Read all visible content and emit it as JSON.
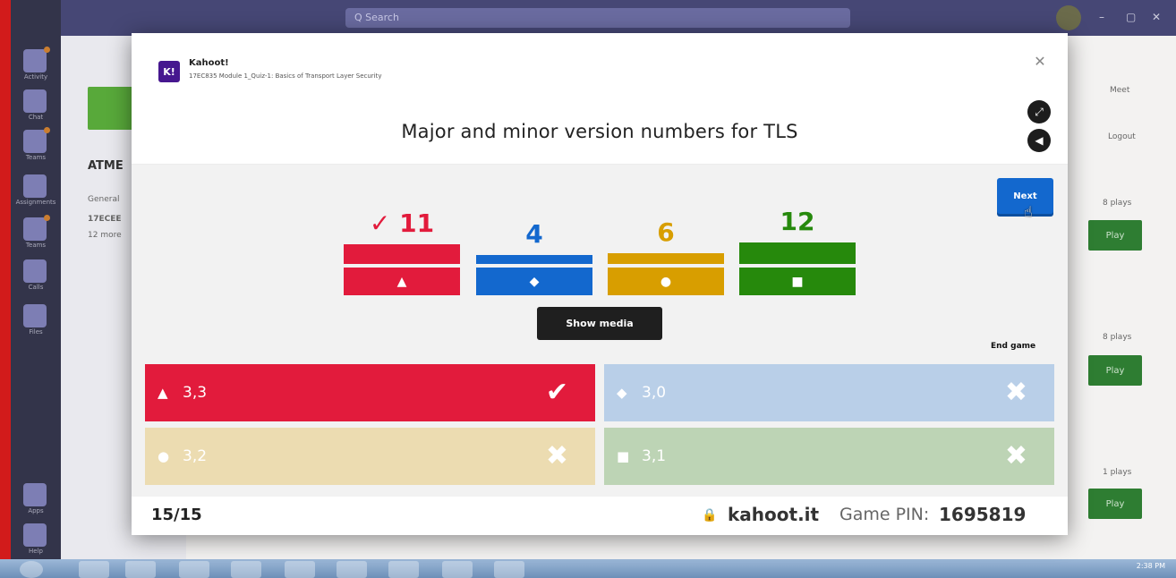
{
  "teams": {
    "search_placeholder": "Q Search",
    "team_title": "ATME",
    "list_items": [
      "General",
      "17ECEE",
      "12 more"
    ],
    "rail_labels": [
      "Activity",
      "Chat",
      "Teams",
      "Assignments",
      "Teams",
      "Calls",
      "Files",
      "Apps",
      "Help"
    ],
    "right_items": [
      "Play",
      "Play",
      "Play"
    ],
    "right_meta": [
      "Logout",
      "8 plays",
      "8 plays",
      "1 plays"
    ],
    "meet_label": "Meet",
    "taskbar_clock": "2:38 PM"
  },
  "kahoot": {
    "app_name": "Kahoot!",
    "logo_text": "K!",
    "subtitle": "17EC835 Module 1_Quiz-1: Basics of Transport Layer Security",
    "question": "Major and minor version numbers for TLS",
    "next_label": "Next",
    "show_media_label": "Show media",
    "end_game_label": "End game",
    "results": [
      {
        "count_label": "✓ 11",
        "count": 11,
        "color": "#e21b3c",
        "shape": "triangle",
        "correct": true
      },
      {
        "count_label": "4",
        "count": 4,
        "color": "#1368ce",
        "shape": "diamond",
        "correct": false
      },
      {
        "count_label": "6",
        "count": 6,
        "color": "#d89e00",
        "shape": "circle",
        "correct": false
      },
      {
        "count_label": "12",
        "count": 12,
        "color": "#26890c",
        "shape": "square",
        "correct": false
      }
    ],
    "answers": [
      {
        "text": "3,3",
        "color": "#e21b3c",
        "shape": "triangle",
        "correct": true
      },
      {
        "text": "3,0",
        "color": "#b9cfe8",
        "shape": "diamond",
        "correct": false
      },
      {
        "text": "3,2",
        "color": "#ecdcb1",
        "shape": "circle",
        "correct": false
      },
      {
        "text": "3,1",
        "color": "#bdd4b5",
        "shape": "square",
        "correct": false
      }
    ],
    "footer": {
      "progress": "15/15",
      "site": "kahoot.it",
      "pin_label": "Game PIN:",
      "pin": "1695819"
    }
  }
}
